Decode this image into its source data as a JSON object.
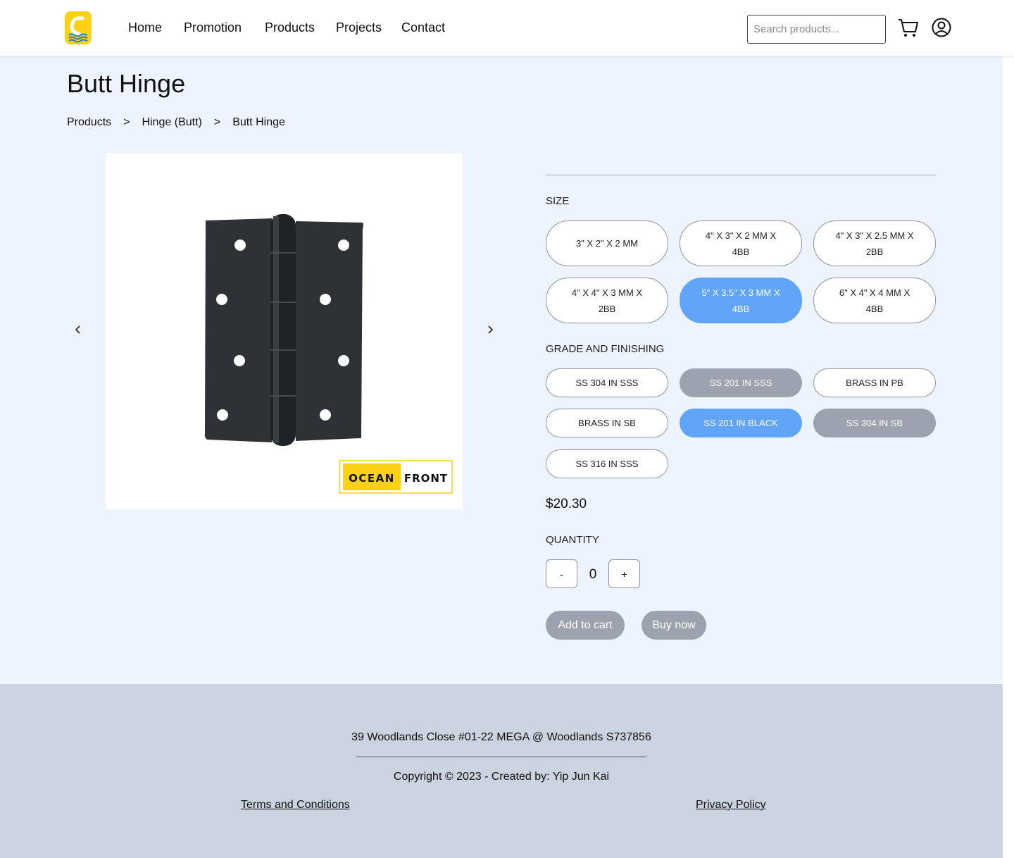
{
  "nav": {
    "items": [
      "Home",
      "Promotion",
      "Products",
      "Projects",
      "Contact"
    ],
    "search_placeholder": "Search products...",
    "cart_icon": "cart-icon",
    "account_icon": "user-circle-icon"
  },
  "page": {
    "title": "Butt Hinge",
    "breadcrumb": [
      "Products",
      ">",
      "Hinge (Butt)",
      ">",
      "Butt Hinge"
    ]
  },
  "product_image": {
    "brand_left": "OCEAN",
    "brand_right": "FRONT",
    "prev_icon": "chevron-left-icon",
    "next_icon": "chevron-right-icon"
  },
  "options": {
    "size_label": "SIZE",
    "sizes": [
      {
        "label": "3\" X 2\" X 2 MM",
        "state": "default"
      },
      {
        "label": "4\" X 3\" X 2 MM X 4BB",
        "state": "default"
      },
      {
        "label": "4\" X 3\" X 2.5 MM X 2BB",
        "state": "default"
      },
      {
        "label": "4\" X 4\" X 3 MM X 2BB",
        "state": "default"
      },
      {
        "label": "5\" X 3.5\" X 3 MM X 4BB",
        "state": "selected"
      },
      {
        "label": "6\" X 4\" X 4 MM X 4BB",
        "state": "default"
      }
    ],
    "grade_label": "GRADE AND FINISHING",
    "grades": [
      {
        "label": "SS 304 IN SSS",
        "state": "default"
      },
      {
        "label": "SS 201 IN SSS",
        "state": "disabled"
      },
      {
        "label": "BRASS IN PB",
        "state": "default"
      },
      {
        "label": "BRASS IN SB",
        "state": "default"
      },
      {
        "label": "SS 201 IN BLACK",
        "state": "selected"
      },
      {
        "label": "SS 304 IN SB",
        "state": "disabled"
      },
      {
        "label": "SS 316 IN SSS",
        "state": "default"
      }
    ]
  },
  "purchase": {
    "price": "$20.30",
    "quantity_label": "QUANTITY",
    "decrement": "-",
    "quantity": "0",
    "increment": "+",
    "add_to_cart": "Add to cart",
    "buy_now": "Buy now"
  },
  "footer": {
    "address": "39 Woodlands Close #01-22 MEGA @ Woodlands S737856",
    "copyright": "Copyright © 2023 - Created by: Yip Jun Kai",
    "terms": "Terms and Conditions",
    "privacy": "Privacy Policy"
  },
  "colors": {
    "page_bg": "#eef4fe",
    "selected": "#60a5fa",
    "disabled": "#9ca3af",
    "footer_bg": "#cad3df",
    "logo_yellow": "#fcd116"
  }
}
